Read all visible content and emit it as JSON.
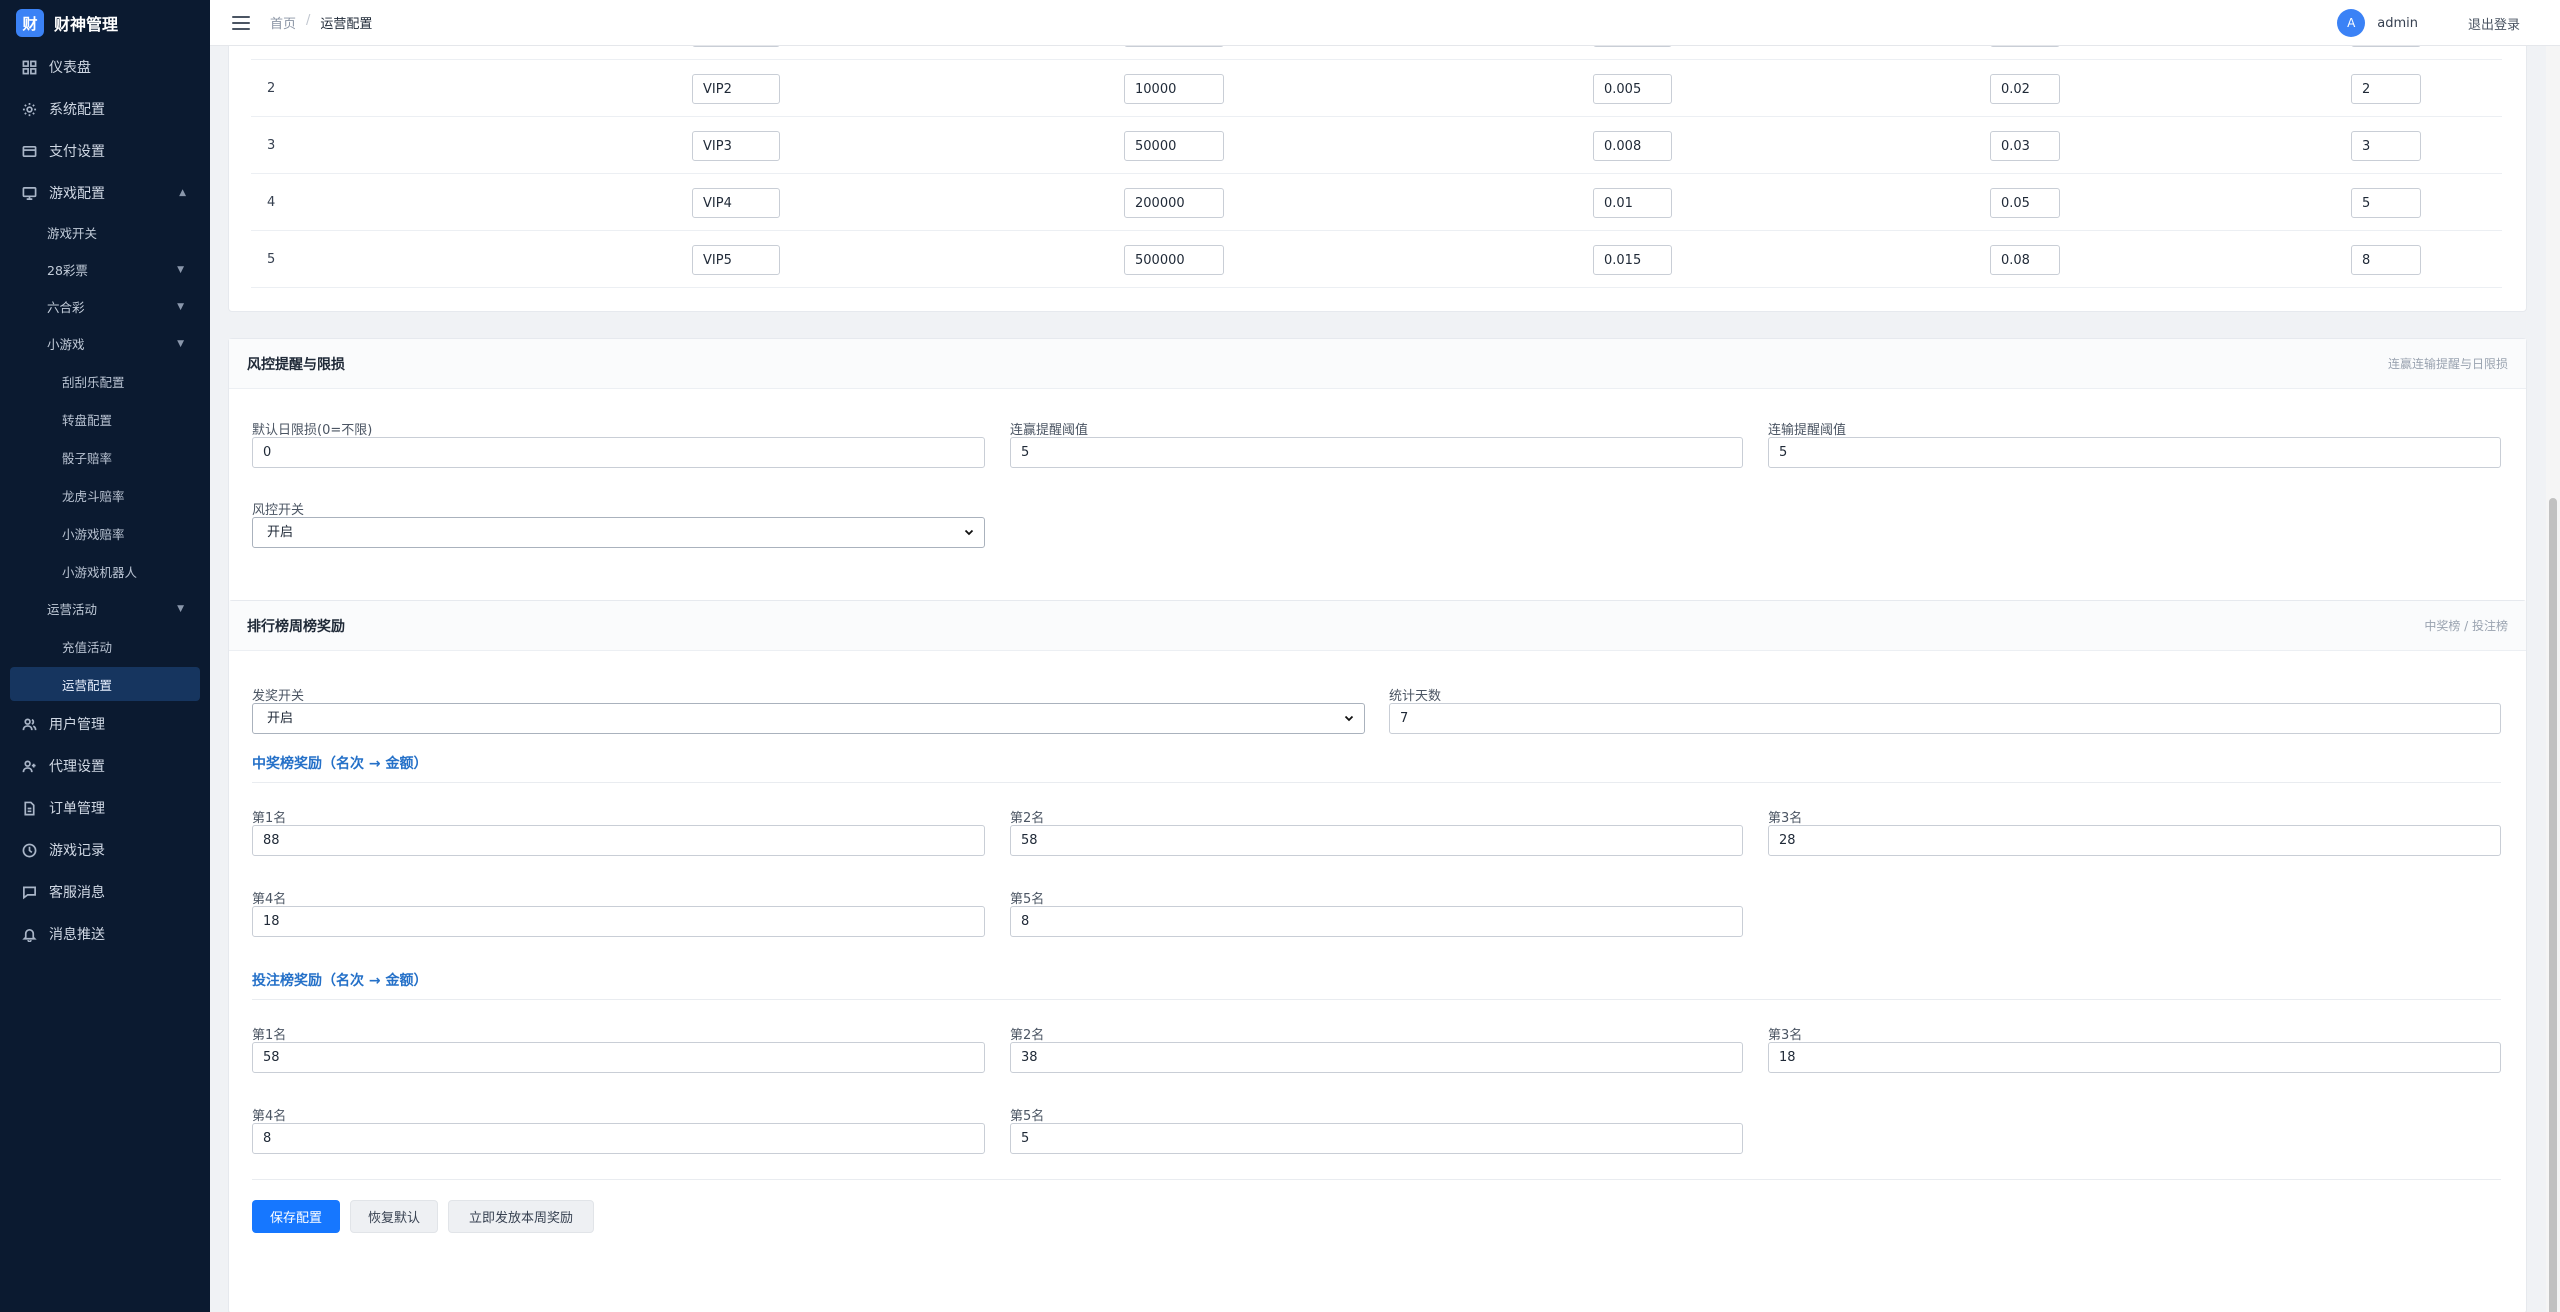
{
  "brand": {
    "logo_char": "财",
    "name": "财神管理"
  },
  "sidebar": {
    "items": [
      {
        "label": "仪表盘",
        "icon": "dashboard-icon"
      },
      {
        "label": "系统配置",
        "icon": "gear-icon"
      },
      {
        "label": "支付设置",
        "icon": "card-icon"
      },
      {
        "label": "游戏配置",
        "icon": "monitor-icon"
      }
    ],
    "game_sub": [
      {
        "label": "游戏开关"
      },
      {
        "label": "28彩票"
      },
      {
        "label": "六合彩"
      },
      {
        "label": "小游戏"
      }
    ],
    "mini_sub": [
      {
        "label": "刮刮乐配置"
      },
      {
        "label": "转盘配置"
      },
      {
        "label": "骰子赔率"
      },
      {
        "label": "龙虎斗赔率"
      },
      {
        "label": "小游戏赔率"
      },
      {
        "label": "小游戏机器人"
      }
    ],
    "ops": {
      "label": "运营活动"
    },
    "ops_sub": [
      {
        "label": "充值活动"
      },
      {
        "label": "运营配置"
      }
    ],
    "bottom_items": [
      {
        "label": "用户管理",
        "icon": "users-icon"
      },
      {
        "label": "代理设置",
        "icon": "user-plus-icon"
      },
      {
        "label": "订单管理",
        "icon": "document-icon"
      },
      {
        "label": "游戏记录",
        "icon": "clock-icon"
      },
      {
        "label": "客服消息",
        "icon": "chat-icon"
      },
      {
        "label": "消息推送",
        "icon": "bell-icon"
      }
    ]
  },
  "header": {
    "breadcrumb": {
      "home": "首页",
      "sep": "/",
      "current": "运营配置"
    },
    "user": {
      "avatar": "A",
      "name": "admin"
    },
    "logout": "退出登录"
  },
  "vip": {
    "rows": [
      {
        "level": "",
        "name": "",
        "threshold": "",
        "rate_a": "",
        "rate_b": "",
        "count": ""
      },
      {
        "level": "2",
        "name": "VIP2",
        "threshold": "10000",
        "rate_a": "0.005",
        "rate_b": "0.02",
        "count": "2"
      },
      {
        "level": "3",
        "name": "VIP3",
        "threshold": "50000",
        "rate_a": "0.008",
        "rate_b": "0.03",
        "count": "3"
      },
      {
        "level": "4",
        "name": "VIP4",
        "threshold": "200000",
        "rate_a": "0.01",
        "rate_b": "0.05",
        "count": "5"
      },
      {
        "level": "5",
        "name": "VIP5",
        "threshold": "500000",
        "rate_a": "0.015",
        "rate_b": "0.08",
        "count": "8"
      }
    ]
  },
  "risk": {
    "title": "风控提醒与限损",
    "hint": "连赢连输提醒与日限损",
    "daily_loss_label": "默认日限损(0=不限)",
    "daily_loss_value": "0",
    "win_streak_label": "连赢提醒阈值",
    "win_streak_value": "5",
    "lose_streak_label": "连输提醒阈值",
    "lose_streak_value": "5",
    "switch_label": "风控开关",
    "switch_value": "开启"
  },
  "rank": {
    "title": "排行榜周榜奖励",
    "hint": "中奖榜 / 投注榜",
    "switch_label": "发奖开关",
    "switch_value": "开启",
    "days_label": "统计天数",
    "days_value": "7",
    "win_section": "中奖榜奖励（名次 → 金额）",
    "win": [
      {
        "label": "第1名",
        "value": "88"
      },
      {
        "label": "第2名",
        "value": "58"
      },
      {
        "label": "第3名",
        "value": "28"
      },
      {
        "label": "第4名",
        "value": "18"
      },
      {
        "label": "第5名",
        "value": "8"
      }
    ],
    "bet_section": "投注榜奖励（名次 → 金额）",
    "bet": [
      {
        "label": "第1名",
        "value": "58"
      },
      {
        "label": "第2名",
        "value": "38"
      },
      {
        "label": "第3名",
        "value": "18"
      },
      {
        "label": "第4名",
        "value": "8"
      },
      {
        "label": "第5名",
        "value": "5"
      }
    ],
    "buttons": {
      "save": "保存配置",
      "reset": "恢复默认",
      "issue": "立即发放本周奖励"
    }
  },
  "colors": {
    "sidebar_bg": "#0b1a30",
    "active_bg": "#16355f",
    "primary": "#1677ff",
    "section_title": "#2470c8"
  }
}
